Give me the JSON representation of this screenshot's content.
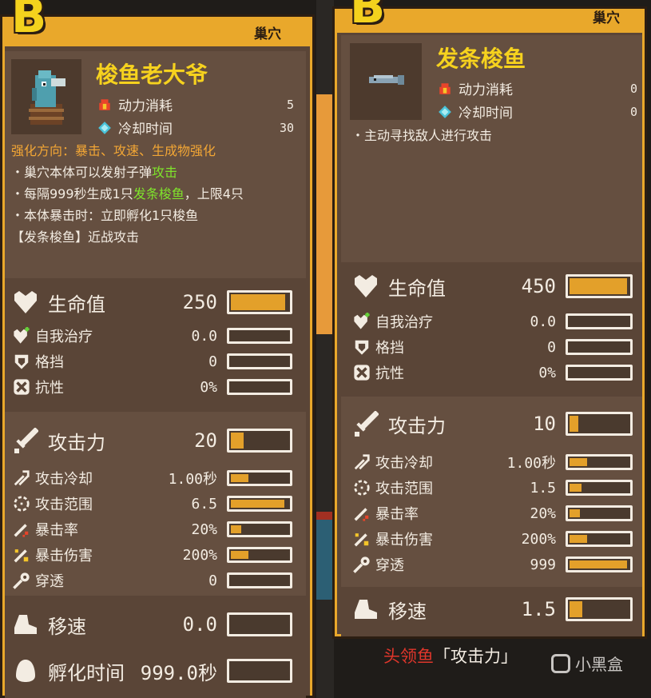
{
  "left": {
    "grade": "B",
    "tag": "巢穴",
    "name": "梭鱼老大爷",
    "costs": [
      {
        "icon": "fire-icon",
        "label": "动力消耗",
        "value": "5"
      },
      {
        "icon": "crystal-icon",
        "label": "冷却时间",
        "value": "30"
      }
    ],
    "direction_prefix": "强化方向：",
    "direction": "暴击、攻速、生成物强化",
    "lines": [
      {
        "pre": "・巢穴本体可以发射子弹",
        "hl": "攻击",
        "post": ""
      },
      {
        "pre": "・每隔999秒生成1只",
        "hl": "发条梭鱼",
        "post": "，上限4只"
      },
      {
        "pre": "・本体暴击时：立即孵化1只梭鱼",
        "hl": "",
        "post": ""
      },
      {
        "pre": "【发条梭鱼】近战攻击",
        "hl": "",
        "post": ""
      }
    ],
    "hp": {
      "label": "生命值",
      "value": "250",
      "fill": 0.95
    },
    "defense": [
      {
        "icon": "heal-icon",
        "label": "自我治疗",
        "value": "0.0",
        "fill": 0
      },
      {
        "icon": "shield-icon",
        "label": "格挡",
        "value": "0",
        "fill": 0
      },
      {
        "icon": "resist-icon",
        "label": "抗性",
        "value": "0%",
        "fill": 0
      }
    ],
    "atk": {
      "label": "攻击力",
      "value": "20",
      "fill": 0.22
    },
    "offense": [
      {
        "icon": "cooldown-icon",
        "label": "攻击冷却",
        "value": "1.00秒",
        "fill": 0.3
      },
      {
        "icon": "range-icon",
        "label": "攻击范围",
        "value": "6.5",
        "fill": 0.93
      },
      {
        "icon": "crit-icon",
        "label": "暴击率",
        "value": "20%",
        "fill": 0.18
      },
      {
        "icon": "crit-damage-icon",
        "label": "暴击伤害",
        "value": "200%",
        "fill": 0.3
      },
      {
        "icon": "pierce-icon",
        "label": "穿透",
        "value": "0",
        "fill": 0
      }
    ],
    "speed": {
      "label": "移速",
      "value": "0.0",
      "fill": 0
    },
    "hatch": {
      "label": "孵化时间",
      "value": "999.0秒",
      "fill": 0
    }
  },
  "right": {
    "grade": "B",
    "tag": "巢穴",
    "name": "发条梭鱼",
    "costs": [
      {
        "icon": "fire-icon",
        "label": "动力消耗",
        "value": "0"
      },
      {
        "icon": "crystal-icon",
        "label": "冷却时间",
        "value": "0"
      }
    ],
    "lines": [
      {
        "pre": "・主动寻找敌人进行攻击",
        "hl": "",
        "post": ""
      }
    ],
    "hp": {
      "label": "生命值",
      "value": "450",
      "fill": 0.97
    },
    "defense": [
      {
        "icon": "heal-icon",
        "label": "自我治疗",
        "value": "0.0",
        "fill": 0
      },
      {
        "icon": "shield-icon",
        "label": "格挡",
        "value": "0",
        "fill": 0
      },
      {
        "icon": "resist-icon",
        "label": "抗性",
        "value": "0%",
        "fill": 0
      }
    ],
    "atk": {
      "label": "攻击力",
      "value": "10",
      "fill": 0.15
    },
    "offense": [
      {
        "icon": "cooldown-icon",
        "label": "攻击冷却",
        "value": "1.00秒",
        "fill": 0.3
      },
      {
        "icon": "range-icon",
        "label": "攻击范围",
        "value": "1.5",
        "fill": 0.2
      },
      {
        "icon": "crit-icon",
        "label": "暴击率",
        "value": "20%",
        "fill": 0.18
      },
      {
        "icon": "crit-damage-icon",
        "label": "暴击伤害",
        "value": "200%",
        "fill": 0.3
      },
      {
        "icon": "pierce-icon",
        "label": "穿透",
        "value": "999",
        "fill": 0.97
      }
    ],
    "speed": {
      "label": "移速",
      "value": "1.5",
      "fill": 0.22
    }
  },
  "footer": {
    "boss": "头领鱼",
    "tag": "「攻击力」",
    "logo": "小黑盒"
  },
  "colors": {
    "frame": "#e9a82b",
    "panel": "#5a4537",
    "bar_fill": "#e3a02a",
    "title": "#f6d21e",
    "highlight": "#7fe52b",
    "direction": "#f2a635"
  }
}
